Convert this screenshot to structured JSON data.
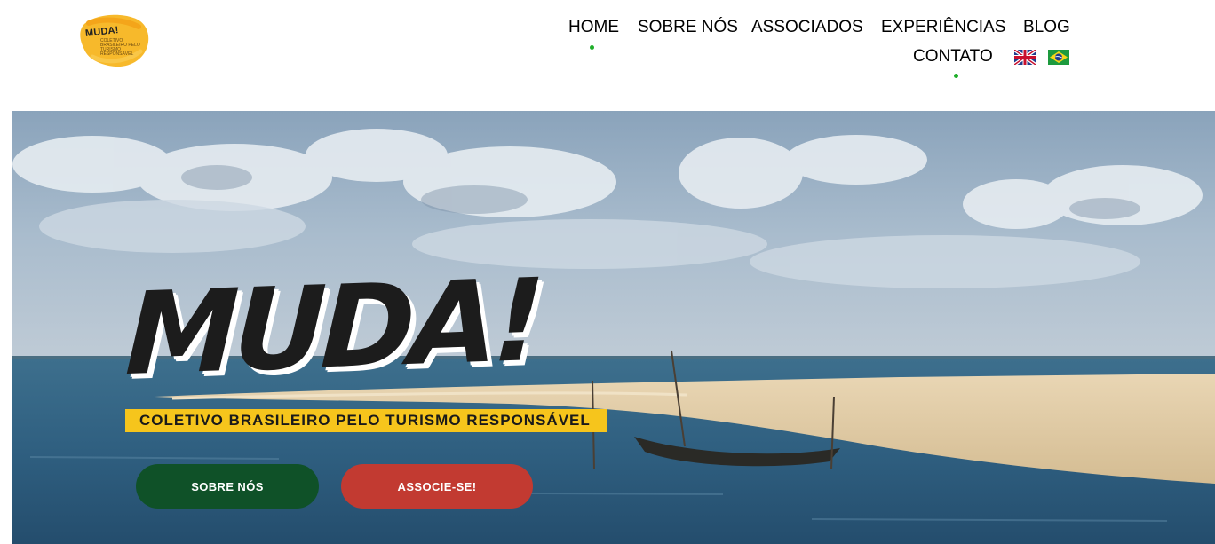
{
  "logo": {
    "text": "MUDA!",
    "sub": "COLETIVO BRASILEIRO PELO TURISMO RESPONSÁVEL"
  },
  "nav": {
    "items": [
      "HOME",
      "SOBRE NÓS",
      "ASSOCIADOS",
      "EXPERIÊNCIAS",
      "BLOG",
      "CONTATO"
    ],
    "languages": [
      "english-flag-icon",
      "brazil-flag-icon"
    ],
    "accent_color": "#1fae2a"
  },
  "hero": {
    "brand": "MUDA!",
    "tagline": "COLETIVO BRASILEIRO PELO TURISMO RESPONSÁVEL",
    "buttons": {
      "about": "SOBRE NÓS",
      "join": "ASSOCIE-SE!"
    },
    "colors": {
      "tagline_bg": "#f6c51c",
      "about_bg": "#0f5128",
      "join_bg": "#c23a31"
    }
  }
}
